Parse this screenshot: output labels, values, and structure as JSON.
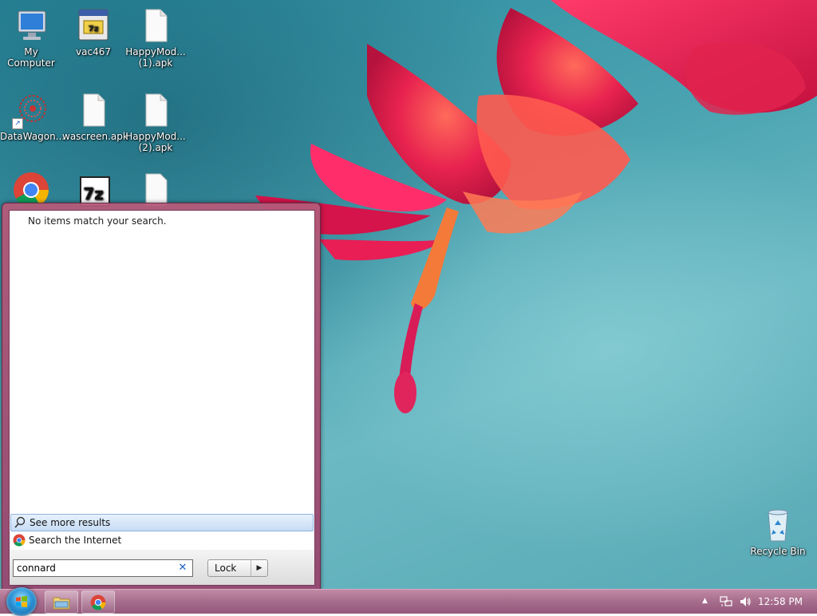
{
  "desktop": {
    "icons": [
      {
        "label": "My Computer"
      },
      {
        "label": "vac467"
      },
      {
        "label": "HappyMod... (1).apk"
      },
      {
        "label": "DataWagon..."
      },
      {
        "label": "wascreen.apk"
      },
      {
        "label": "HappyMod... (2).apk"
      },
      {
        "label": "Recycle Bin"
      }
    ]
  },
  "start_menu": {
    "no_results": "No items match your search.",
    "see_more": "See more results",
    "search_internet": "Search the Internet",
    "search_value": "connard",
    "lock_label": "Lock"
  },
  "taskbar": {
    "clock": "12:58 PM"
  }
}
